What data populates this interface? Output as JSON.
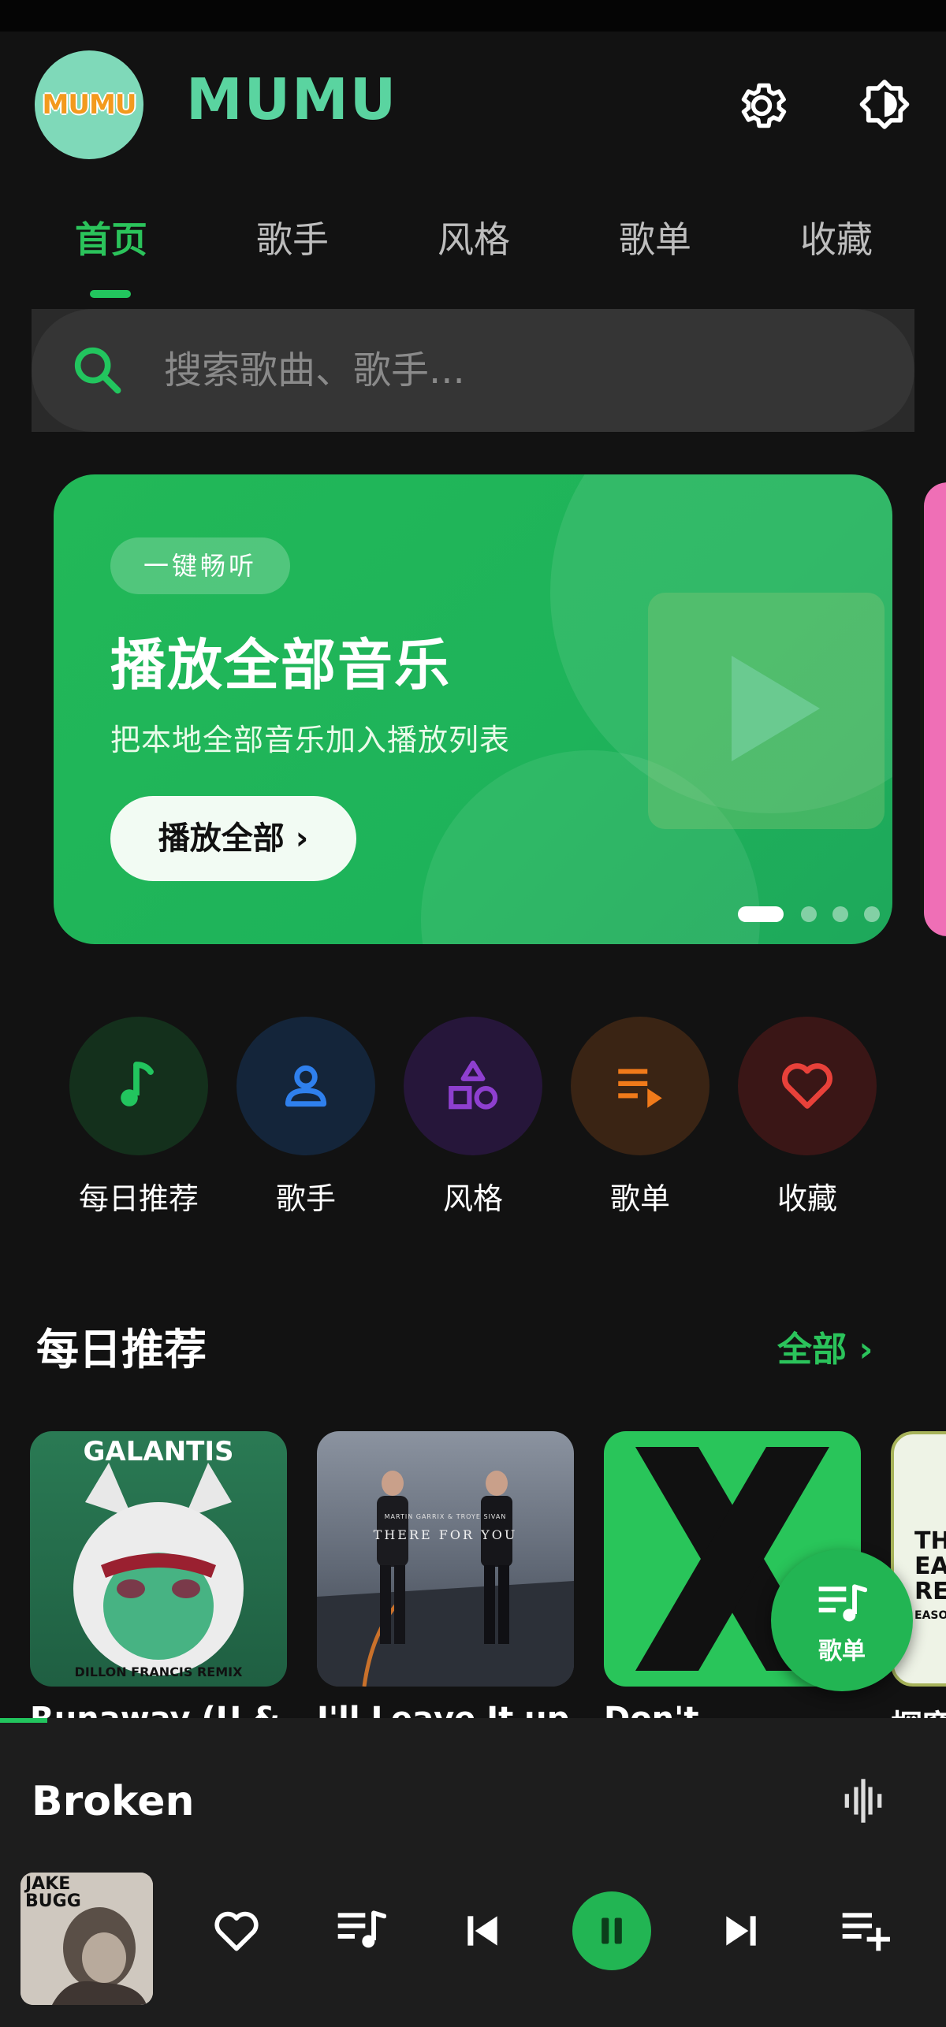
{
  "app": {
    "title": "MUMU",
    "logo_text": "MUMU"
  },
  "tabs": [
    {
      "label": "首页",
      "active": true
    },
    {
      "label": "歌手",
      "active": false
    },
    {
      "label": "风格",
      "active": false
    },
    {
      "label": "歌单",
      "active": false
    },
    {
      "label": "收藏",
      "active": false
    }
  ],
  "search": {
    "placeholder": "搜索歌曲、歌手..."
  },
  "banner": {
    "badge": "一键畅听",
    "title": "播放全部音乐",
    "subtitle": "把本地全部音乐加入播放列表",
    "button": "播放全部 ›",
    "page_count": 4,
    "active_index": 0
  },
  "quick": [
    {
      "label": "每日推荐",
      "icon": "music-note-icon",
      "color": "#22c55e",
      "bg": "#14301c"
    },
    {
      "label": "歌手",
      "icon": "person-icon",
      "color": "#2f80ed",
      "bg": "#14253a"
    },
    {
      "label": "风格",
      "icon": "shapes-icon",
      "color": "#8e3fcf",
      "bg": "#26163a"
    },
    {
      "label": "歌单",
      "icon": "playlist-icon",
      "color": "#f07a1a",
      "bg": "#3a2414"
    },
    {
      "label": "收藏",
      "icon": "heart-icon",
      "color": "#e8413a",
      "bg": "#3a1616"
    }
  ],
  "section": {
    "title": "每日推荐",
    "more": "全部 ›"
  },
  "cards": [
    {
      "title": "Runaway (U & I)",
      "cover_text": "GALANTIS",
      "cover_sub": "DILLON FRANCIS REMIX"
    },
    {
      "title": "I'll Leave It up",
      "cover_text": "THERE FOR YOU",
      "cover_sub": "MARTIN GARRIX & TROYE SIVAN"
    },
    {
      "title": "Don't",
      "cover_text": "X",
      "cover_sub": ""
    },
    {
      "title": "探窗",
      "cover_text": "TH EA RE",
      "cover_sub": "EASO"
    }
  ],
  "fab": {
    "label": "歌单"
  },
  "player": {
    "title": "Broken",
    "album_text": "JAKE BUGG",
    "progress": 0.05,
    "state": "playing"
  },
  "colors": {
    "accent": "#22c55e",
    "background": "#121212"
  }
}
